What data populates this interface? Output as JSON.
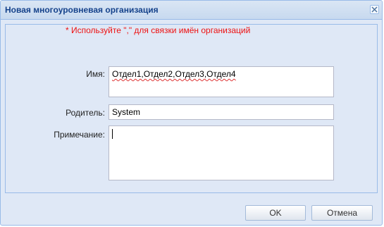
{
  "dialog": {
    "title": "Новая многоуровневая организация",
    "close_icon": "close-icon"
  },
  "form": {
    "hint": "* Используйте \",\" для связки имён организаций",
    "name_label": "Имя:",
    "name_value": "Отдел1,Отдел2,Отдел3,Отдел4",
    "parent_label": "Родитель:",
    "parent_value": "System",
    "note_label": "Примечание:",
    "note_value": ""
  },
  "buttons": {
    "ok": "OK",
    "cancel": "Отмена"
  },
  "colors": {
    "title_text": "#15428b",
    "hint_text": "#ee1111",
    "panel_bg": "#dfe8f6",
    "border": "#99bbe8"
  }
}
